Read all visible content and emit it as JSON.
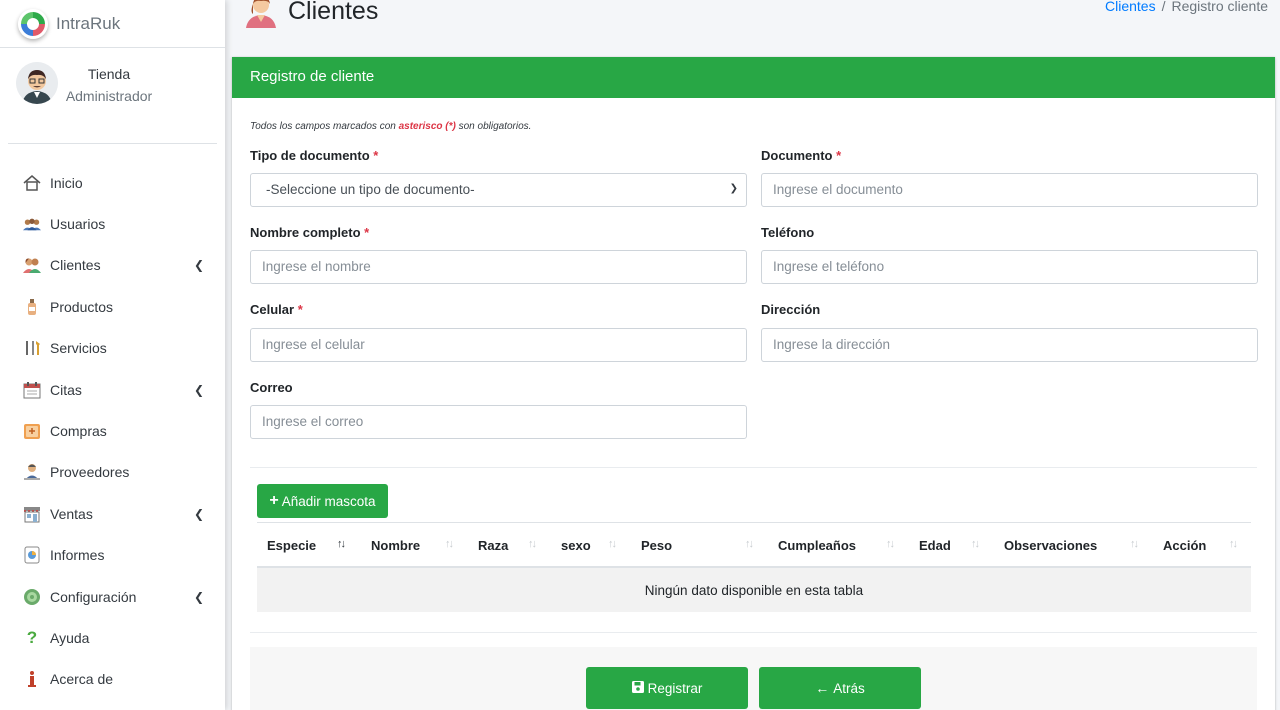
{
  "brand": {
    "name": "IntraRuk"
  },
  "user": {
    "name": "Tienda",
    "role": "Administrador"
  },
  "sidebar": {
    "items": [
      {
        "label": "Inicio",
        "icon": "home-icon",
        "chevron": false
      },
      {
        "label": "Usuarios",
        "icon": "users-icon",
        "chevron": false
      },
      {
        "label": "Clientes",
        "icon": "clients-icon",
        "chevron": true
      },
      {
        "label": "Productos",
        "icon": "product-bottle-icon",
        "chevron": false
      },
      {
        "label": "Servicios",
        "icon": "services-tools-icon",
        "chevron": false
      },
      {
        "label": "Citas",
        "icon": "calendar-icon",
        "chevron": true
      },
      {
        "label": "Compras",
        "icon": "purchase-box-icon",
        "chevron": false
      },
      {
        "label": "Proveedores",
        "icon": "supplier-icon",
        "chevron": false
      },
      {
        "label": "Ventas",
        "icon": "store-icon",
        "chevron": true
      },
      {
        "label": "Informes",
        "icon": "report-icon",
        "chevron": false
      },
      {
        "label": "Configuración",
        "icon": "settings-icon",
        "chevron": true
      },
      {
        "label": "Ayuda",
        "icon": "help-icon",
        "chevron": false
      },
      {
        "label": "Acerca de",
        "icon": "info-icon",
        "chevron": false
      }
    ]
  },
  "header": {
    "title": "Clientes",
    "breadcrumb": {
      "link": "Clientes",
      "separator": "/",
      "current": "Registro cliente"
    }
  },
  "card": {
    "title": "Registro de cliente"
  },
  "form": {
    "note_prefix": "Todos los campos marcados con ",
    "note_highlight": "asterisco (*)",
    "note_suffix": " son obligatorios.",
    "tipo_documento": {
      "label": "Tipo de documento",
      "required": "*",
      "value": "-Seleccione un tipo de documento-"
    },
    "documento": {
      "label": "Documento",
      "required": "*",
      "placeholder": "Ingrese el documento"
    },
    "nombre": {
      "label": "Nombre completo",
      "required": "*",
      "placeholder": "Ingrese el nombre"
    },
    "telefono": {
      "label": "Teléfono",
      "placeholder": "Ingrese el teléfono"
    },
    "celular": {
      "label": "Celular",
      "required": "*",
      "placeholder": "Ingrese el celular"
    },
    "direccion": {
      "label": "Dirección",
      "placeholder": "Ingrese la dirección"
    },
    "correo": {
      "label": "Correo",
      "placeholder": "Ingrese el correo"
    }
  },
  "pets": {
    "add_button": "Añadir mascota",
    "columns": [
      "Especie",
      "Nombre",
      "Raza",
      "sexo",
      "Peso",
      "Cumpleaños",
      "Edad",
      "Observaciones",
      "Acción"
    ],
    "empty_message": "Ningún dato disponible en esta tabla"
  },
  "actions": {
    "register": "Registrar",
    "back": "Atrás"
  },
  "colors": {
    "primary_green": "#28a745",
    "link_blue": "#007bff",
    "required_red": "#dc3545"
  }
}
